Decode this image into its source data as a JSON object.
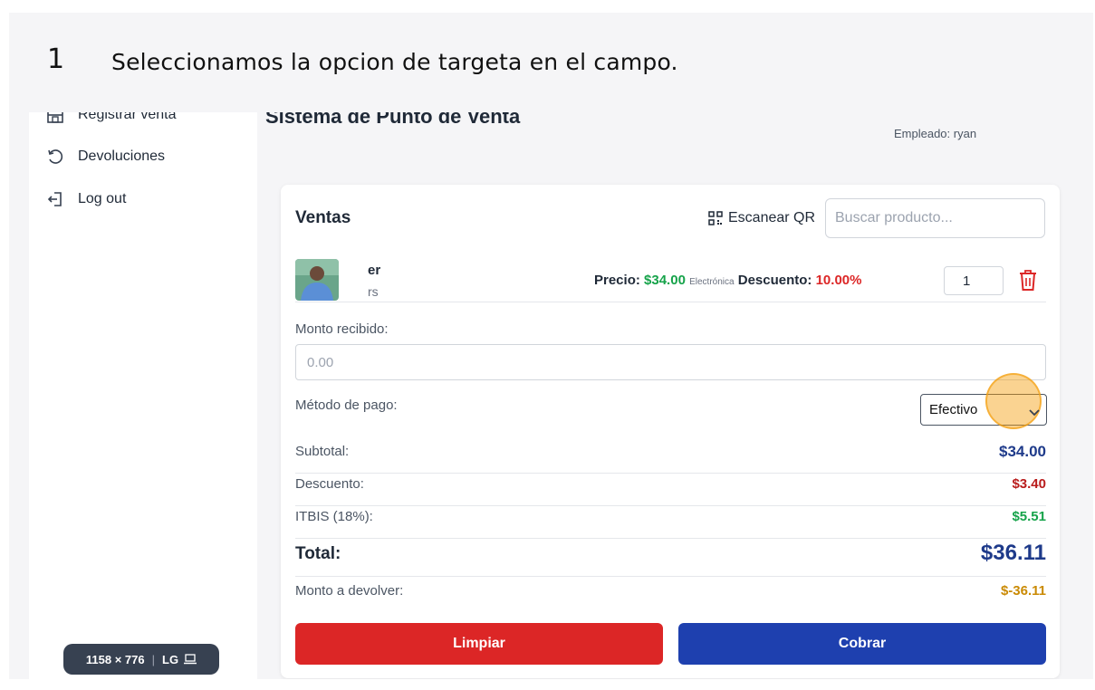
{
  "step": {
    "number": "1",
    "instruction": "Seleccionamos la opcion de targeta en el campo."
  },
  "sidebar": {
    "items": [
      {
        "label": "Registrar venta",
        "icon": "store-icon"
      },
      {
        "label": "Devoluciones",
        "icon": "undo-icon"
      },
      {
        "label": "Log out",
        "icon": "logout-icon"
      }
    ]
  },
  "viewport_badge": {
    "size": "1158 × 776",
    "breakpoint": "LG",
    "icon": "laptop-icon"
  },
  "header": {
    "title": "Sistema de Punto de Venta",
    "employee": "Empleado: ryan"
  },
  "sales": {
    "title": "Ventas",
    "scan_qr_label": "Escanear QR",
    "search_placeholder": "Buscar producto...",
    "product": {
      "name": "er",
      "code": "rs",
      "price_label": "Precio:",
      "price": "$34.00",
      "category": "Electrónica",
      "discount_label": "Descuento:",
      "discount": "10.00%",
      "quantity": "1"
    },
    "amount_received_label": "Monto recibido:",
    "amount_received_placeholder": "0.00",
    "payment_method_label": "Método de pago:",
    "payment_method_value": "Efectivo",
    "subtotal_label": "Subtotal:",
    "subtotal": "$34.00",
    "discount_label": "Descuento:",
    "discount_amount": "$3.40",
    "tax_label": "ITBIS (18%):",
    "tax": "$5.51",
    "total_label": "Total:",
    "total": "$36.11",
    "change_label": "Monto a devolver:",
    "change": "$-36.11",
    "clear_button": "Limpiar",
    "charge_button": "Cobrar"
  },
  "colors": {
    "green": "#16a34a",
    "red": "#dc2626",
    "navy": "#1e3a8a",
    "gold": "#ca8a04",
    "clear_button": "#dc2626",
    "charge_button": "#1e40af",
    "highlight": "#f59e0b"
  }
}
